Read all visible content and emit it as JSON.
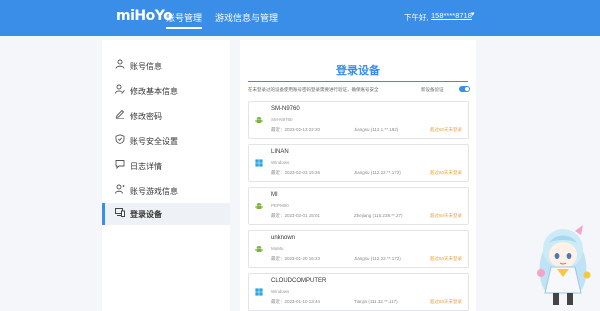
{
  "header": {
    "logo": "miHoYo",
    "tabs": [
      {
        "label": "账号管理"
      },
      {
        "label": "游戏信息与管理"
      }
    ],
    "greeting": "下午好,",
    "phone": "158****8718"
  },
  "sidebar": {
    "items": [
      {
        "label": "账号信息",
        "icon": "user-icon"
      },
      {
        "label": "修改基本信息",
        "icon": "user-edit-icon"
      },
      {
        "label": "修改密码",
        "icon": "pencil-icon"
      },
      {
        "label": "账号安全设置",
        "icon": "shield-icon"
      },
      {
        "label": "日志详情",
        "icon": "chat-icon"
      },
      {
        "label": "账号游戏信息",
        "icon": "user-game-icon"
      },
      {
        "label": "登录设备",
        "icon": "devices-icon"
      }
    ],
    "active_index": 6
  },
  "main": {
    "title": "登录设备",
    "description": "在未登录过的设备使用账号密码登录需要进行验证，确保账号安全",
    "toggle_label": "新设备验证",
    "toggle_on": true,
    "devices": [
      {
        "name": "SM-N9760",
        "os": "SM-N9760",
        "os_icon": "android-icon",
        "time": "最近：2023-02-13 22:20",
        "location": "Jiangsu (112.1.**.192)",
        "action": "超过60天未登录"
      },
      {
        "name": "LINAN",
        "os": "Windows",
        "os_icon": "windows-icon",
        "time": "最近：2023-02-03 19:26",
        "location": "Jiangsu (112.22.**.173)",
        "action": "超过60天未登录"
      },
      {
        "name": "MI",
        "os": "PEPM00",
        "os_icon": "android-icon",
        "time": "最近：2023-02-01 15:01",
        "location": "Zhejiang (115.238.**.27)",
        "action": "超过60天未登录"
      },
      {
        "name": "unknown",
        "os": "MuMu",
        "os_icon": "android-icon",
        "time": "最近：2023-01-20 16:23",
        "location": "Jiangsu (112.22.**.173)",
        "action": "超过60天未登录"
      },
      {
        "name": "CLOUDCOMPUTER",
        "os": "Windows",
        "os_icon": "windows-icon",
        "time": "最近：2023-01-10 13:44",
        "location": "Tianjin (111.32.**.117)",
        "action": "超过60天未登录"
      }
    ]
  },
  "colors": {
    "brand": "#3b8ee8",
    "android": "#7cb342",
    "windows": "#29a8e0",
    "warning": "#e6a23c"
  }
}
